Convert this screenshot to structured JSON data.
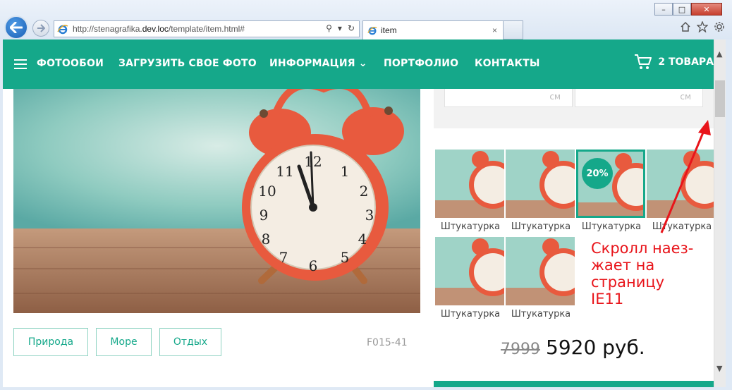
{
  "browser": {
    "address_prefix": "http://stenagrafika.",
    "address_domain": "dev.loc",
    "address_path": "/template/item.html#",
    "tab_title": "item",
    "tab_close": "×"
  },
  "nav": {
    "items": [
      {
        "label": "ФОТООБОИ"
      },
      {
        "label": "ЗАГРУЗИТЬ СВОЕ ФОТО"
      },
      {
        "label": "ИНФОРМАЦИЯ"
      },
      {
        "label": "ПОРТФОЛИО"
      },
      {
        "label": "КОНТАКТЫ"
      }
    ],
    "cart_label": "2 ТОВАРА"
  },
  "size_fields": [
    {
      "unit": "см"
    },
    {
      "unit": "см"
    }
  ],
  "tags": [
    {
      "label": "Природа"
    },
    {
      "label": "Море"
    },
    {
      "label": "Отдых"
    }
  ],
  "sku": "F015-41",
  "textures": [
    {
      "label": "Штукатурка",
      "selected": false
    },
    {
      "label": "Штукатурка",
      "selected": false
    },
    {
      "label": "Штукатурка",
      "selected": true,
      "badge": "20%"
    },
    {
      "label": "Штукатурка",
      "selected": false
    },
    {
      "label": "Штукатурка",
      "selected": false
    },
    {
      "label": "Штукатурка",
      "selected": false
    }
  ],
  "price": {
    "old": "7999",
    "new": "5920 руб."
  },
  "annotation": {
    "line1": "Скролл наез-",
    "line2": "жает на",
    "line3": "страницу",
    "line4": "IE11"
  },
  "colors": {
    "accent": "#15a88a",
    "annotation": "#e8141a"
  }
}
